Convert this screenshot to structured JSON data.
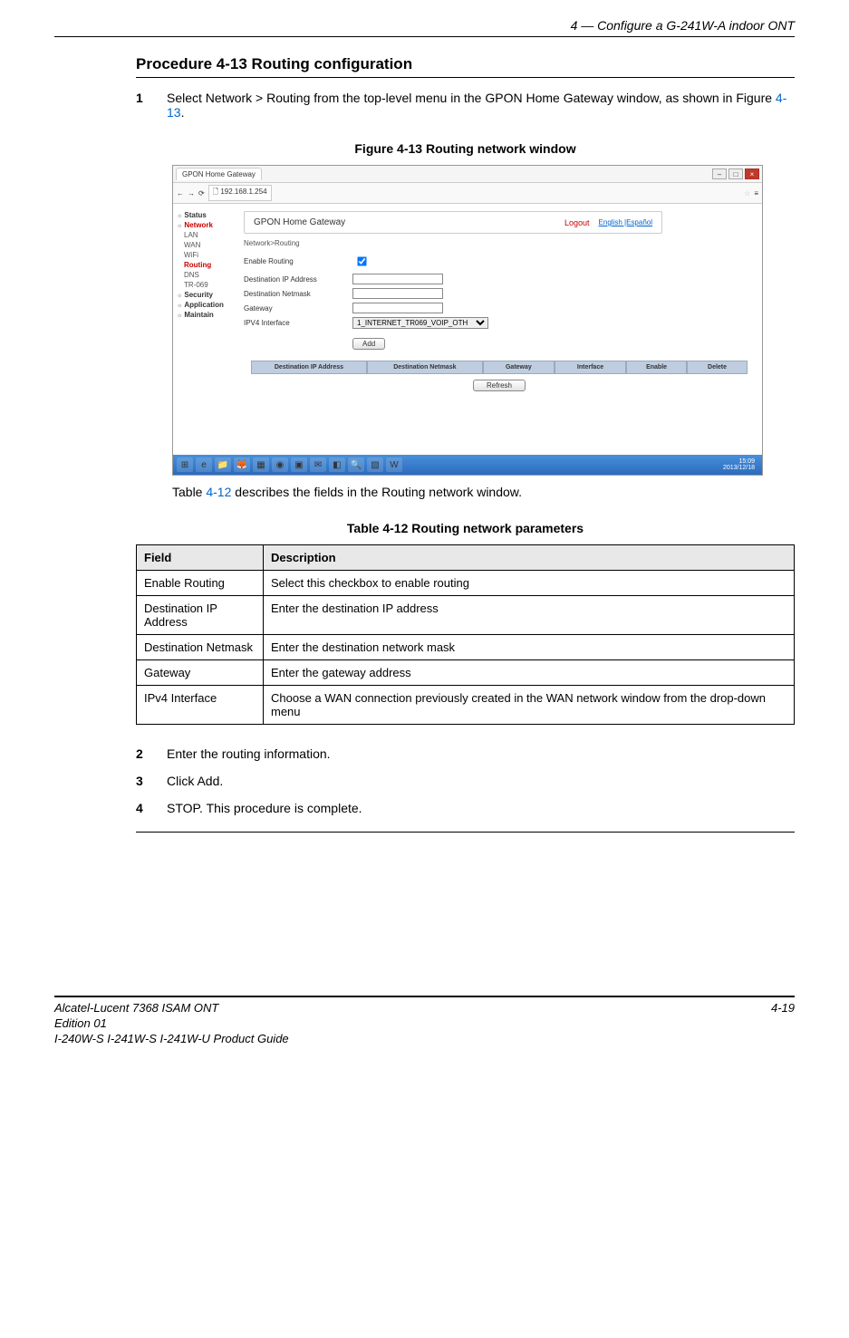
{
  "header": {
    "chapter": "4 —  Configure a G-241W-A indoor ONT"
  },
  "procedure": {
    "title": "Procedure 4-13  Routing configuration",
    "steps": [
      {
        "num": "1",
        "text_before": "Select Network > Routing from the top-level menu in the GPON Home Gateway window, as shown in Figure ",
        "ref": "4-13",
        "text_after": "."
      },
      {
        "num": "2",
        "text": "Enter the routing information."
      },
      {
        "num": "3",
        "text": "Click Add."
      },
      {
        "num": "4",
        "text": "STOP. This procedure is complete."
      }
    ]
  },
  "figure": {
    "caption": "Figure 4-13  Routing network window",
    "tab_title": "GPON Home Gateway",
    "url": "192.168.1.254",
    "brand": "GPON Home Gateway",
    "logout": "Logout",
    "lang": "English |Español",
    "crumb": "Network>Routing",
    "side": {
      "status": "Status",
      "network": "Network",
      "lan": "LAN",
      "wan": "WAN",
      "wifi": "WiFi",
      "routing": "Routing",
      "dns": "DNS",
      "tr069": "TR-069",
      "security": "Security",
      "application": "Application",
      "maintain": "Maintain"
    },
    "form": {
      "enable": "Enable Routing",
      "destip": "Destination IP Address",
      "destmask": "Destination Netmask",
      "gateway": "Gateway",
      "ipv4if": "IPV4 Interface",
      "ipv4opt": "1_INTERNET_TR069_VOIP_OTH",
      "add": "Add",
      "refresh": "Refresh"
    },
    "thead": {
      "c1": "Destination IP Address",
      "c2": "Destination Netmask",
      "c3": "Gateway",
      "c4": "Interface",
      "c5": "Enable",
      "c6": "Delete"
    },
    "taskbar_time": "15:09",
    "taskbar_date": "2013/12/18"
  },
  "table_desc": {
    "pre": "Table ",
    "ref": "4-12",
    "post": " describes the fields in the Routing network window."
  },
  "table": {
    "caption": "Table 4-12 Routing network parameters",
    "hField": "Field",
    "hDesc": "Description",
    "rows": [
      {
        "f": "Enable Routing",
        "d": "Select this checkbox to enable routing"
      },
      {
        "f": "Destination IP Address",
        "d": "Enter the destination IP address"
      },
      {
        "f": "Destination Netmask",
        "d": "Enter the destination network mask"
      },
      {
        "f": "Gateway",
        "d": "Enter the gateway address"
      },
      {
        "f": "IPv4 Interface",
        "d": "Choose a WAN connection previously created in the WAN network window from the drop-down menu"
      }
    ]
  },
  "footer": {
    "l1": "Alcatel-Lucent 7368 ISAM ONT",
    "l2": "Edition 01",
    "l3": "I-240W-S I-241W-S I-241W-U Product Guide",
    "page": "4-19"
  }
}
